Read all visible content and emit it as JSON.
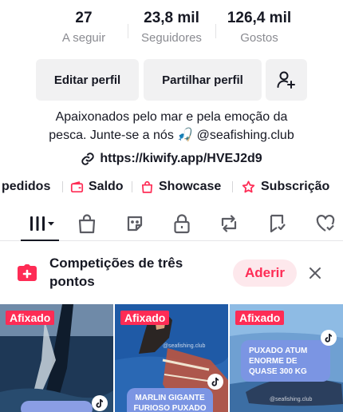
{
  "stats": [
    {
      "value": "27",
      "label": "A seguir"
    },
    {
      "value": "23,8 mil",
      "label": "Seguidores"
    },
    {
      "value": "126,4 mil",
      "label": "Gostos"
    }
  ],
  "buttons": {
    "edit_profile": "Editar perfil",
    "share_profile": "Partilhar perfil",
    "add_friend_icon": "person-plus-icon"
  },
  "bio": {
    "line1": "Apaixonados pelo mar e pela emoção da",
    "line2": "pesca. Junte-se a nós 🎣 @seafishing.club"
  },
  "link": "https://kiwify.app/HVEJ2d9",
  "quick_links": [
    {
      "label": "pedidos",
      "icon": "orders-icon"
    },
    {
      "label": "Saldo",
      "icon": "wallet-icon"
    },
    {
      "label": "Showcase",
      "icon": "shopping-bag-icon"
    },
    {
      "label": "Subscrição",
      "icon": "subscription-icon"
    }
  ],
  "tabs": [
    {
      "icon": "grid-videos-icon",
      "active": true
    },
    {
      "icon": "shop-bag-icon"
    },
    {
      "icon": "sticker-icon"
    },
    {
      "icon": "lock-icon"
    },
    {
      "icon": "repost-icon"
    },
    {
      "icon": "bookmark-icon"
    },
    {
      "icon": "liked-heart-icon"
    }
  ],
  "banner": {
    "title": "Competições de três pontos",
    "join_label": "Aderir",
    "accent": "#fe2c55"
  },
  "videos": [
    {
      "pinned_label": "Afixado",
      "caption": ""
    },
    {
      "pinned_label": "Afixado",
      "caption": "MARLIN GIGANTE FURIOSO PUXADO",
      "watermark": "@seafishing.club"
    },
    {
      "pinned_label": "Afixado",
      "caption": "PUXADO ATUM ENORME DE QUASE 300 KG",
      "watermark": "@seafishing.club"
    }
  ],
  "colors": {
    "text": "#161823",
    "muted": "#8a8b91",
    "button_bg": "#f1f1f2",
    "brand_red": "#fe2c55"
  }
}
